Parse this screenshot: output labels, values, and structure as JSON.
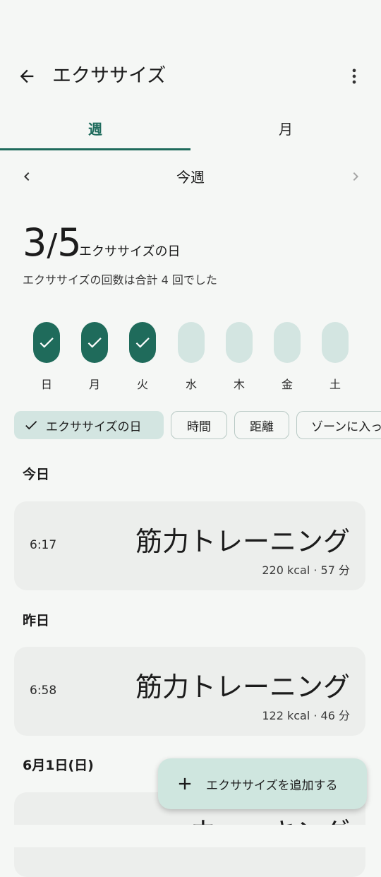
{
  "header": {
    "title": "エクササイズ",
    "back_icon": "arrow-back-icon",
    "menu_icon": "more-vert-icon"
  },
  "tabs": [
    {
      "label": "週",
      "selected": true
    },
    {
      "label": "月",
      "selected": false
    }
  ],
  "period": {
    "label": "今週",
    "prev_icon": "chevron-left-icon",
    "next_icon": "chevron-right-icon"
  },
  "summary": {
    "count": "3",
    "goal": "5",
    "unit_label": "エクササイズの日",
    "description": "エクササイズの回数は合計 4 回でした"
  },
  "days": [
    {
      "label": "日",
      "done": true
    },
    {
      "label": "月",
      "done": true
    },
    {
      "label": "火",
      "done": true
    },
    {
      "label": "水",
      "done": false
    },
    {
      "label": "木",
      "done": false
    },
    {
      "label": "金",
      "done": false
    },
    {
      "label": "土",
      "done": false
    }
  ],
  "filters": [
    {
      "label": "エクササイズの日",
      "selected": true
    },
    {
      "label": "時間",
      "selected": false
    },
    {
      "label": "距離",
      "selected": false
    },
    {
      "label": "ゾーンに入っ",
      "selected": false
    }
  ],
  "sections": [
    {
      "heading": "今日",
      "items": [
        {
          "time": "6:17",
          "name": "筋力トレーニング",
          "meta": "220 kcal · 57 分"
        }
      ]
    },
    {
      "heading": "昨日",
      "items": [
        {
          "time": "6:58",
          "name": "筋力トレーニング",
          "meta": "122 kcal · 46 分"
        }
      ]
    },
    {
      "heading": "6月1日(日)",
      "items": [
        {
          "time": "",
          "name": "ウォーキング",
          "meta": ""
        }
      ]
    }
  ],
  "fab": {
    "label": "エクササイズを追加する",
    "icon": "plus-icon"
  },
  "colors": {
    "accent": "#1e6b5c",
    "pill_done": "#1f6b5b",
    "pill_empty": "#d3e5e1",
    "background": "#f5f7f5",
    "card": "#eceeec",
    "fab": "#cfe6df"
  }
}
